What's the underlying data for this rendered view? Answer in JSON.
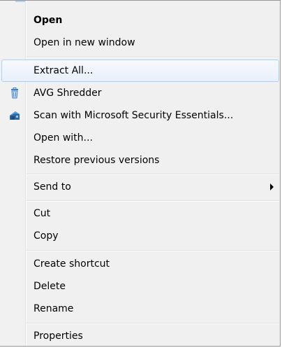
{
  "menu": {
    "items": [
      {
        "label": "Open",
        "bold": true
      },
      {
        "label": "Open in new window"
      },
      {
        "label": "Extract All...",
        "hovered": true
      },
      {
        "label": "AVG Shredder",
        "icon": "shredder-bin-icon"
      },
      {
        "label": "Scan with Microsoft Security Essentials...",
        "icon": "security-essentials-house-icon"
      },
      {
        "label": "Open with..."
      },
      {
        "label": "Restore previous versions"
      },
      {
        "label": "Send to",
        "submenu": true
      },
      {
        "label": "Cut"
      },
      {
        "label": "Copy"
      },
      {
        "label": "Create shortcut"
      },
      {
        "label": "Delete"
      },
      {
        "label": "Rename"
      },
      {
        "label": "Properties"
      }
    ]
  },
  "colors": {
    "hover_border": "#aecff7",
    "menu_background": "#f0f0f0",
    "shredder_icon": "#3a7ec7",
    "security_icon": "#2d6aa3"
  }
}
